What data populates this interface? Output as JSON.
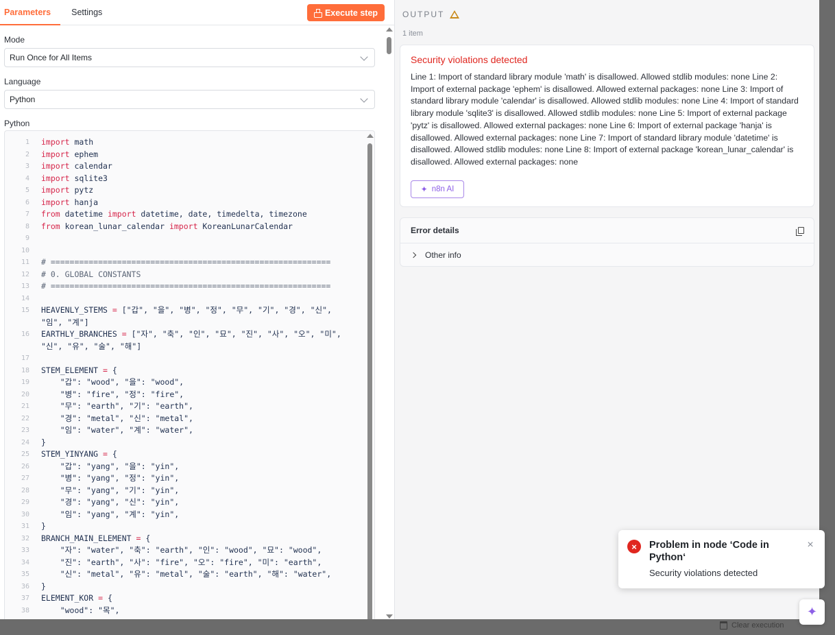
{
  "tabs": [
    {
      "label": "Parameters",
      "active": true
    },
    {
      "label": "Settings",
      "active": false
    }
  ],
  "execute_label": "Execute step",
  "mode": {
    "label": "Mode",
    "value": "Run Once for All Items"
  },
  "language": {
    "label": "Language",
    "value": "Python"
  },
  "editor_label": "Python",
  "code_lines": [
    {
      "n": "1",
      "parts": [
        [
          "kw",
          "import"
        ],
        [
          "t",
          " math"
        ]
      ]
    },
    {
      "n": "2",
      "parts": [
        [
          "kw",
          "import"
        ],
        [
          "t",
          " ephem"
        ]
      ]
    },
    {
      "n": "3",
      "parts": [
        [
          "kw",
          "import"
        ],
        [
          "t",
          " calendar"
        ]
      ]
    },
    {
      "n": "4",
      "parts": [
        [
          "kw",
          "import"
        ],
        [
          "t",
          " sqlite3"
        ]
      ]
    },
    {
      "n": "5",
      "parts": [
        [
          "kw",
          "import"
        ],
        [
          "t",
          " pytz"
        ]
      ]
    },
    {
      "n": "6",
      "parts": [
        [
          "kw",
          "import"
        ],
        [
          "t",
          " hanja"
        ]
      ]
    },
    {
      "n": "7",
      "parts": [
        [
          "kw",
          "from"
        ],
        [
          "t",
          " datetime "
        ],
        [
          "kw",
          "import"
        ],
        [
          "t",
          " datetime, date, timedelta, timezone"
        ]
      ]
    },
    {
      "n": "8",
      "parts": [
        [
          "kw",
          "from"
        ],
        [
          "t",
          " korean_lunar_calendar "
        ],
        [
          "kw",
          "import"
        ],
        [
          "t",
          " KoreanLunarCalendar"
        ]
      ]
    },
    {
      "n": "9",
      "parts": []
    },
    {
      "n": "10",
      "parts": []
    },
    {
      "n": "11",
      "parts": [
        [
          "cm",
          "# ==========================================================="
        ]
      ]
    },
    {
      "n": "12",
      "parts": [
        [
          "cm",
          "# 0. GLOBAL CONSTANTS"
        ]
      ]
    },
    {
      "n": "13",
      "parts": [
        [
          "cm",
          "# ==========================================================="
        ]
      ]
    },
    {
      "n": "14",
      "parts": []
    },
    {
      "n": "15",
      "parts": [
        [
          "t",
          "HEAVENLY_STEMS "
        ],
        [
          "op",
          "="
        ],
        [
          "t",
          " [\"갑\", \"을\", \"병\", \"정\", \"무\", \"기\", \"경\", \"신\","
        ]
      ]
    },
    {
      "n": "",
      "parts": [
        [
          "t",
          "\"임\", \"계\"]"
        ]
      ]
    },
    {
      "n": "16",
      "parts": [
        [
          "t",
          "EARTHLY_BRANCHES "
        ],
        [
          "op",
          "="
        ],
        [
          "t",
          " [\"자\", \"축\", \"인\", \"묘\", \"진\", \"사\", \"오\", \"미\","
        ]
      ]
    },
    {
      "n": "",
      "parts": [
        [
          "t",
          "\"신\", \"유\", \"술\", \"해\"]"
        ]
      ]
    },
    {
      "n": "17",
      "parts": []
    },
    {
      "n": "18",
      "parts": [
        [
          "t",
          "STEM_ELEMENT "
        ],
        [
          "op",
          "="
        ],
        [
          "t",
          " {"
        ]
      ]
    },
    {
      "n": "19",
      "parts": [
        [
          "t",
          "    \"갑\": \"wood\", \"을\": \"wood\","
        ]
      ]
    },
    {
      "n": "20",
      "parts": [
        [
          "t",
          "    \"병\": \"fire\", \"정\": \"fire\","
        ]
      ]
    },
    {
      "n": "21",
      "parts": [
        [
          "t",
          "    \"무\": \"earth\", \"기\": \"earth\","
        ]
      ]
    },
    {
      "n": "22",
      "parts": [
        [
          "t",
          "    \"경\": \"metal\", \"신\": \"metal\","
        ]
      ]
    },
    {
      "n": "23",
      "parts": [
        [
          "t",
          "    \"임\": \"water\", \"계\": \"water\","
        ]
      ]
    },
    {
      "n": "24",
      "parts": [
        [
          "t",
          "}"
        ]
      ]
    },
    {
      "n": "25",
      "parts": [
        [
          "t",
          "STEM_YINYANG "
        ],
        [
          "op",
          "="
        ],
        [
          "t",
          " {"
        ]
      ]
    },
    {
      "n": "26",
      "parts": [
        [
          "t",
          "    \"갑\": \"yang\", \"을\": \"yin\","
        ]
      ]
    },
    {
      "n": "27",
      "parts": [
        [
          "t",
          "    \"병\": \"yang\", \"정\": \"yin\","
        ]
      ]
    },
    {
      "n": "28",
      "parts": [
        [
          "t",
          "    \"무\": \"yang\", \"기\": \"yin\","
        ]
      ]
    },
    {
      "n": "29",
      "parts": [
        [
          "t",
          "    \"경\": \"yang\", \"신\": \"yin\","
        ]
      ]
    },
    {
      "n": "30",
      "parts": [
        [
          "t",
          "    \"임\": \"yang\", \"계\": \"yin\","
        ]
      ]
    },
    {
      "n": "31",
      "parts": [
        [
          "t",
          "}"
        ]
      ]
    },
    {
      "n": "32",
      "parts": [
        [
          "t",
          "BRANCH_MAIN_ELEMENT "
        ],
        [
          "op",
          "="
        ],
        [
          "t",
          " {"
        ]
      ]
    },
    {
      "n": "33",
      "parts": [
        [
          "t",
          "    \"자\": \"water\", \"축\": \"earth\", \"인\": \"wood\", \"묘\": \"wood\","
        ]
      ]
    },
    {
      "n": "34",
      "parts": [
        [
          "t",
          "    \"진\": \"earth\", \"사\": \"fire\", \"오\": \"fire\", \"미\": \"earth\","
        ]
      ]
    },
    {
      "n": "35",
      "parts": [
        [
          "t",
          "    \"신\": \"metal\", \"유\": \"metal\", \"술\": \"earth\", \"해\": \"water\","
        ]
      ]
    },
    {
      "n": "36",
      "parts": [
        [
          "t",
          "}"
        ]
      ]
    },
    {
      "n": "37",
      "parts": [
        [
          "t",
          "ELEMENT_KOR "
        ],
        [
          "op",
          "="
        ],
        [
          "t",
          " {"
        ]
      ]
    },
    {
      "n": "38",
      "parts": [
        [
          "t",
          "    \"wood\": \"목\","
        ]
      ]
    }
  ],
  "output": {
    "title": "OUTPUT",
    "item_count": "1 item",
    "error_title": "Security violations detected",
    "error_message": "Line 1: Import of standard library module 'math' is disallowed. Allowed stdlib modules: none Line 2: Import of external package 'ephem' is disallowed. Allowed external packages: none Line 3: Import of standard library module 'calendar' is disallowed. Allowed stdlib modules: none Line 4: Import of standard library module 'sqlite3' is disallowed. Allowed stdlib modules: none Line 5: Import of external package 'pytz' is disallowed. Allowed external packages: none Line 6: Import of external package 'hanja' is disallowed. Allowed external packages: none Line 7: Import of standard library module 'datetime' is disallowed. Allowed stdlib modules: none Line 8: Import of external package 'korean_lunar_calendar' is disallowed. Allowed external packages: none",
    "ai_button": "n8n AI",
    "details_title": "Error details",
    "other_info": "Other info"
  },
  "toast": {
    "title": "Problem in node ‘Code in Python‘",
    "message": "Security violations detected"
  },
  "background": {
    "clear_execution": "Clear execution"
  },
  "colors": {
    "accent": "#ff6d3a",
    "error": "#e0261f",
    "ai": "#8d5fe6",
    "warning": "#c98a1a"
  },
  "icons": {
    "execute": "flask-icon",
    "warning": "warning-triangle-icon",
    "ai": "sparkle-icon",
    "copy": "copy-icon",
    "toast": "error-circle-icon",
    "close": "close-icon"
  }
}
